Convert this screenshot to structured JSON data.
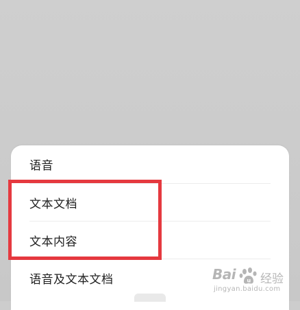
{
  "sheet": {
    "options": [
      {
        "label": "语音"
      },
      {
        "label": "文本文档"
      },
      {
        "label": "文本内容"
      },
      {
        "label": "语音及文本文档"
      }
    ]
  },
  "watermark": {
    "brand_left": "Bai",
    "brand_right": "u",
    "brand_suffix": "经验",
    "url": "jingyan.baidu.com"
  },
  "colors": {
    "highlight": "#e5393f",
    "backdrop": "#cdcdcd",
    "sheet": "#ffffff"
  },
  "icons": {
    "watermark_logo": "baidu-paw-icon"
  }
}
